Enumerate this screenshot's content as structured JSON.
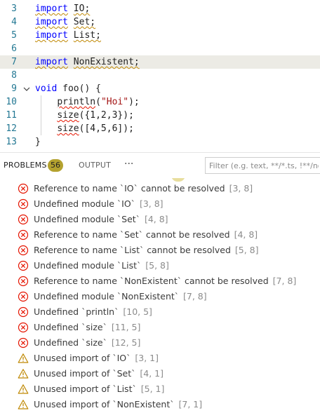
{
  "editor": {
    "lines": [
      {
        "number": "3",
        "tokens": [
          {
            "text": "import",
            "cls": "kw squiggle-warn"
          },
          {
            "text": " ",
            "cls": ""
          },
          {
            "text": "IO;",
            "cls": "squiggle-warn"
          }
        ]
      },
      {
        "number": "4",
        "tokens": [
          {
            "text": "import",
            "cls": "kw squiggle-warn"
          },
          {
            "text": " ",
            "cls": ""
          },
          {
            "text": "Set;",
            "cls": "squiggle-warn"
          }
        ]
      },
      {
        "number": "5",
        "tokens": [
          {
            "text": "import",
            "cls": "kw squiggle-warn"
          },
          {
            "text": " ",
            "cls": ""
          },
          {
            "text": "List;",
            "cls": "squiggle-warn"
          }
        ]
      },
      {
        "number": "6",
        "tokens": []
      },
      {
        "number": "7",
        "tokens": [
          {
            "text": "import",
            "cls": "kw squiggle-warn"
          },
          {
            "text": " ",
            "cls": ""
          },
          {
            "text": "NonExistent;",
            "cls": "squiggle-warn"
          }
        ],
        "highlight": true
      },
      {
        "number": "8",
        "tokens": []
      },
      {
        "number": "9",
        "fold": "chevron-down-icon",
        "tokens": [
          {
            "text": "void",
            "cls": "kw"
          },
          {
            "text": " foo() {",
            "cls": ""
          }
        ]
      },
      {
        "number": "10",
        "tokens": [
          {
            "text": "    ",
            "cls": ""
          },
          {
            "text": "println",
            "cls": "squiggle-err"
          },
          {
            "text": "(",
            "cls": ""
          },
          {
            "text": "\"Hoi\"",
            "cls": "str"
          },
          {
            "text": ");",
            "cls": ""
          }
        ]
      },
      {
        "number": "11",
        "tokens": [
          {
            "text": "    ",
            "cls": ""
          },
          {
            "text": "size",
            "cls": "squiggle-err"
          },
          {
            "text": "({1,2,3});",
            "cls": ""
          }
        ]
      },
      {
        "number": "12",
        "tokens": [
          {
            "text": "    ",
            "cls": ""
          },
          {
            "text": "size",
            "cls": "squiggle-err"
          },
          {
            "text": "([4,5,6]);",
            "cls": ""
          }
        ]
      },
      {
        "number": "13",
        "tokens": [
          {
            "text": "}",
            "cls": ""
          }
        ]
      }
    ]
  },
  "panel": {
    "tabs": {
      "problems": "PROBLEMS",
      "problems_count": "56",
      "output": "OUTPUT",
      "more": "···"
    },
    "filter_placeholder": "Filter (e.g. text, **/*.ts, !**/node_modules/**)"
  },
  "colors": {
    "error": "#e51400",
    "warning": "#bf8803",
    "badge": "#b4a22f",
    "highlight_line": "#ecebe5"
  },
  "problems": [
    {
      "severity": "error",
      "icon": "error-icon",
      "message": "Reference to name `IO` cannot be resolved",
      "location": "[3, 8]"
    },
    {
      "severity": "error",
      "icon": "error-icon",
      "message": "Undefined module `IO`",
      "location": "[3, 8]"
    },
    {
      "severity": "error",
      "icon": "error-icon",
      "message": "Undefined module `Set`",
      "location": "[4, 8]"
    },
    {
      "severity": "error",
      "icon": "error-icon",
      "message": "Reference to name `Set` cannot be resolved",
      "location": "[4, 8]"
    },
    {
      "severity": "error",
      "icon": "error-icon",
      "message": "Reference to name `List` cannot be resolved",
      "location": "[5, 8]"
    },
    {
      "severity": "error",
      "icon": "error-icon",
      "message": "Undefined module `List`",
      "location": "[5, 8]"
    },
    {
      "severity": "error",
      "icon": "error-icon",
      "message": "Reference to name `NonExistent` cannot be resolved",
      "location": "[7, 8]"
    },
    {
      "severity": "error",
      "icon": "error-icon",
      "message": "Undefined module `NonExistent`",
      "location": "[7, 8]"
    },
    {
      "severity": "error",
      "icon": "error-icon",
      "message": "Undefined `println`",
      "location": "[10, 5]"
    },
    {
      "severity": "error",
      "icon": "error-icon",
      "message": "Undefined `size`",
      "location": "[11, 5]"
    },
    {
      "severity": "error",
      "icon": "error-icon",
      "message": "Undefined `size`",
      "location": "[12, 5]"
    },
    {
      "severity": "warning",
      "icon": "warning-icon",
      "message": "Unused import of `IO`",
      "location": "[3, 1]"
    },
    {
      "severity": "warning",
      "icon": "warning-icon",
      "message": "Unused import of `Set`",
      "location": "[4, 1]"
    },
    {
      "severity": "warning",
      "icon": "warning-icon",
      "message": "Unused import of `List`",
      "location": "[5, 1]"
    },
    {
      "severity": "warning",
      "icon": "warning-icon",
      "message": "Unused import of `NonExistent`",
      "location": "[7, 1]"
    }
  ]
}
